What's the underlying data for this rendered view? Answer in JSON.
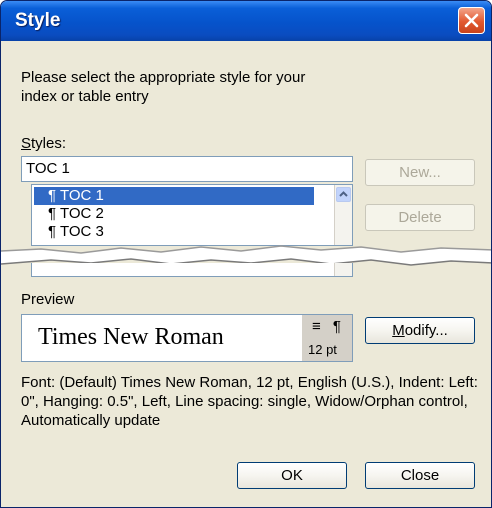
{
  "window": {
    "title": "Style"
  },
  "prompt": "Please select the appropriate style for your index or table entry",
  "styles": {
    "label_prefix": "",
    "label_accel": "S",
    "label_rest": "tyles:",
    "input_value": "TOC 1",
    "items": [
      {
        "mark": "¶",
        "label": "TOC 1",
        "selected": true
      },
      {
        "mark": "¶",
        "label": "TOC 2",
        "selected": false
      },
      {
        "mark": "¶",
        "label": "TOC 3",
        "selected": false
      }
    ]
  },
  "buttons": {
    "new": "New...",
    "delete": "Delete",
    "modify_accel": "M",
    "modify_rest": "odify...",
    "ok": "OK",
    "close": "Close"
  },
  "preview": {
    "label": "Preview",
    "sample_text": "Times New Roman",
    "icons": "≡ ¶",
    "size": "12 pt"
  },
  "description": "Font: (Default) Times New Roman, 12 pt, English (U.S.), Indent: Left:  0\", Hanging:  0.5\", Left, Line spacing:  single, Widow/Orphan control, Automatically update",
  "colors": {
    "titlebar": "#0653cb",
    "selection": "#316ac5",
    "close_button": "#e2582f",
    "dialog_bg": "#ece9d8"
  }
}
